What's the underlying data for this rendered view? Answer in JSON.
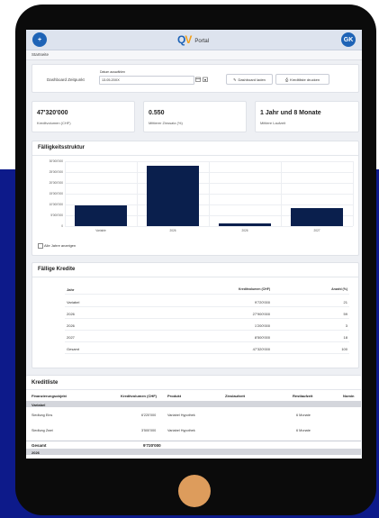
{
  "app": {
    "logo_mark_a": "Q",
    "logo_mark_b": "V",
    "logo_text": "Portal",
    "add_button": "+",
    "user_initials": "GK"
  },
  "breadcrumb": "Startseite",
  "controls": {
    "dashboard_label": "Dashboard Zeitpunkt",
    "date_label": "Datum auswählen",
    "date_value": "13.05.20XX",
    "load_button": "Dashboard laden",
    "print_button": "Kreditliste drucken"
  },
  "kpis": [
    {
      "value": "47'320'000",
      "label": "Kreditvolumen (CHF)"
    },
    {
      "value": "0.550",
      "label": "Mittlerer Zinssatz (%)"
    },
    {
      "value": "1 Jahr und 8 Monate",
      "label": "Mittlere Laufzeit"
    }
  ],
  "maturity": {
    "title": "Fälligkeitsstruktur",
    "checkbox_label": "Alle Jahre anzeigen"
  },
  "chart_data": {
    "type": "bar",
    "categories": [
      "Variable",
      "2026",
      "2026",
      "2027"
    ],
    "values": [
      9720000,
      27900000,
      1200000,
      8500000
    ],
    "y_ticks": [
      "30'000'000",
      "25'000'000",
      "20'000'000",
      "15'000'000",
      "10'000'000",
      "5'000'000",
      "0"
    ],
    "ylim": [
      0,
      30000000
    ],
    "bar_color": "#0a1f4d",
    "grid": true
  },
  "due_loans": {
    "title": "Fällige Kredite",
    "headers": [
      "Jahr",
      "Kreditvolumen (CHF)",
      "Anzahl (%)"
    ],
    "rows": [
      [
        "Variabel",
        "9'720'000",
        "21"
      ],
      [
        "2026",
        "27'900'000",
        "59"
      ],
      [
        "2026",
        "1'200'000",
        "3"
      ],
      [
        "2027",
        "8'500'000",
        "18"
      ],
      [
        "Gesamt",
        "47'320'000",
        "100"
      ]
    ]
  },
  "loan_list": {
    "title": "Kreditliste",
    "headers": [
      "Finanzierungsobjekt",
      "Kreditvolumen (CHF)",
      "Produkt",
      "Zinslaufzeit",
      "Restlaufzeit",
      "Nomin"
    ],
    "group_variable": "Variabel",
    "rows": [
      [
        "Siedlung Eins",
        "6'220'000",
        "Variabel Hypothek",
        "6 Monate"
      ],
      [
        "Siedlung Zwei",
        "3'500'000",
        "Variabel Hypothek",
        "6 Monate"
      ]
    ],
    "total_label": "Gesamt",
    "total_value": "9'720'000",
    "next_group": "2026"
  },
  "colors": {
    "accent": "#1e63b6",
    "logo_orange": "#f2a01b",
    "bar": "#0a1f4d",
    "home_button": "#dd9c5c"
  }
}
